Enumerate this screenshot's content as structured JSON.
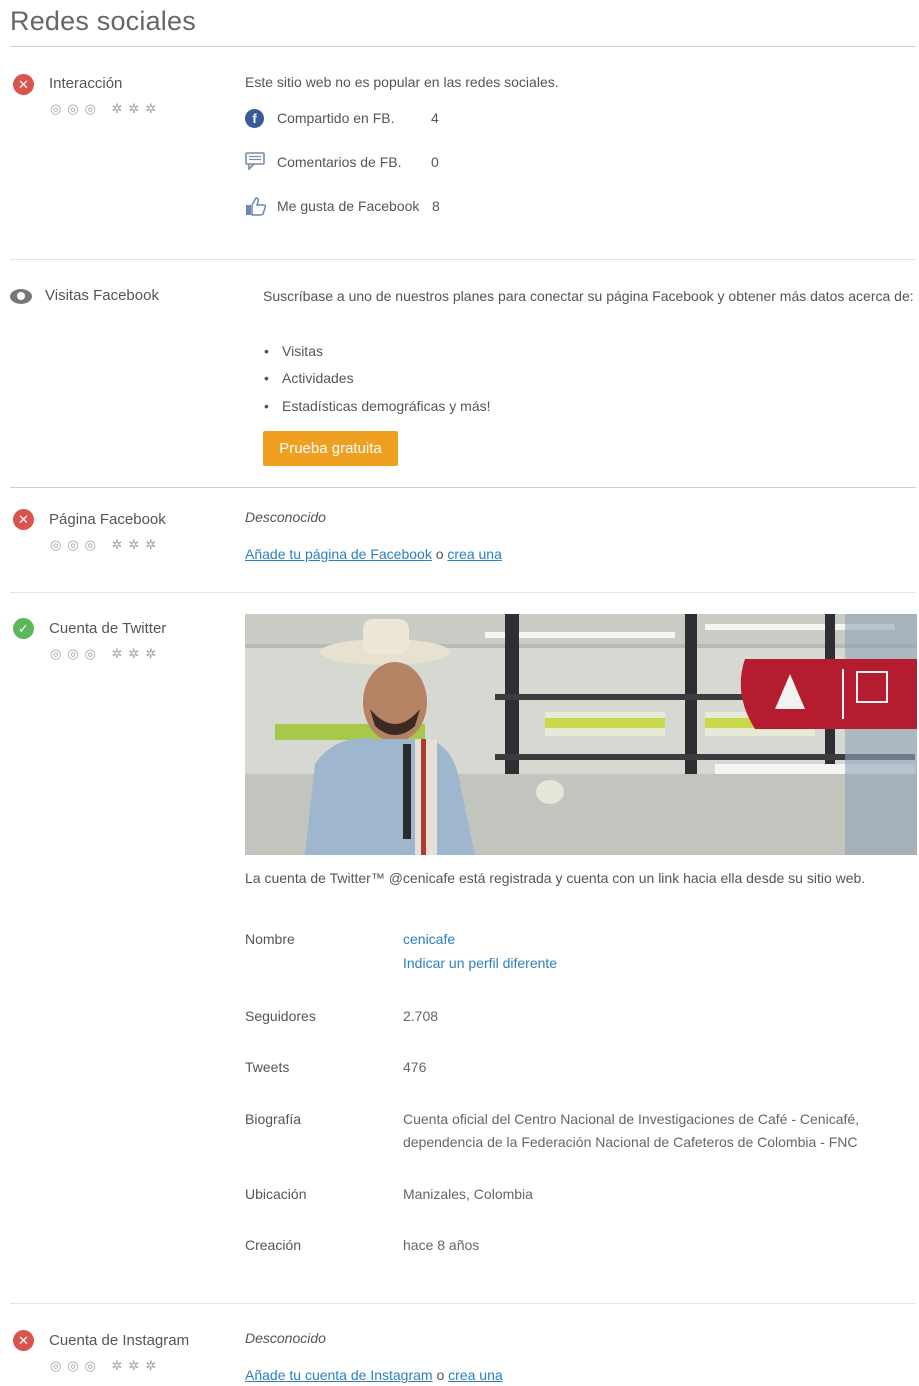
{
  "page": {
    "title": "Redes sociales"
  },
  "importance_icons": "◎◎◎ ✲✲✲",
  "interaccion": {
    "label": "Interacción",
    "summary": "Este sitio web no es popular en las redes sociales.",
    "rows": [
      {
        "label": "Compartido en FB.",
        "value": "4"
      },
      {
        "label": "Comentarios de FB.",
        "value": "0"
      },
      {
        "label": "Me gusta de Facebook",
        "value": "8"
      }
    ]
  },
  "visitas": {
    "label": "Visitas Facebook",
    "description": "Suscríbase a uno de nuestros planes para conectar su página Facebook y obtener más datos acerca de:",
    "bullets": [
      "Visitas",
      "Actividades",
      "Estadísticas demográficas y más!"
    ],
    "button": "Prueba gratuita"
  },
  "pagina_fb": {
    "label": "Página Facebook",
    "status": "Desconocido",
    "link_add": "Añade tu página de Facebook",
    "or": "o",
    "link_create": "crea una"
  },
  "twitter": {
    "label": "Cuenta de Twitter",
    "summary": "La cuenta de Twitter™ @cenicafe está registrada y cuenta con un link hacia ella desde su sitio web.",
    "fields": {
      "nombre_key": "Nombre",
      "nombre_val": "cenicafe",
      "nombre_alt": "Indicar un perfil diferente",
      "seguidores_key": "Seguidores",
      "seguidores_val": "2.708",
      "tweets_key": "Tweets",
      "tweets_val": "476",
      "bio_key": "Biografía",
      "bio_line1": "Cuenta oficial del Centro Nacional de Investigaciones de Café - Cenicafé,",
      "bio_line2": "dependencia de la Federación Nacional de Cafeteros de Colombia - FNC",
      "ubicacion_key": "Ubicación",
      "ubicacion_val": "Manizales, Colombia",
      "creacion_key": "Creación",
      "creacion_val": "hace 8 años"
    }
  },
  "instagram": {
    "label": "Cuenta de Instagram",
    "status": "Desconocido",
    "link_add": "Añade tu cuenta de Instagram",
    "or": "o",
    "link_create": "crea una"
  },
  "colors": {
    "accent": "#f0a020",
    "error": "#d9534f",
    "ok": "#5cb85c",
    "link": "#2c7fc0",
    "facebook": "#3b5a98"
  }
}
